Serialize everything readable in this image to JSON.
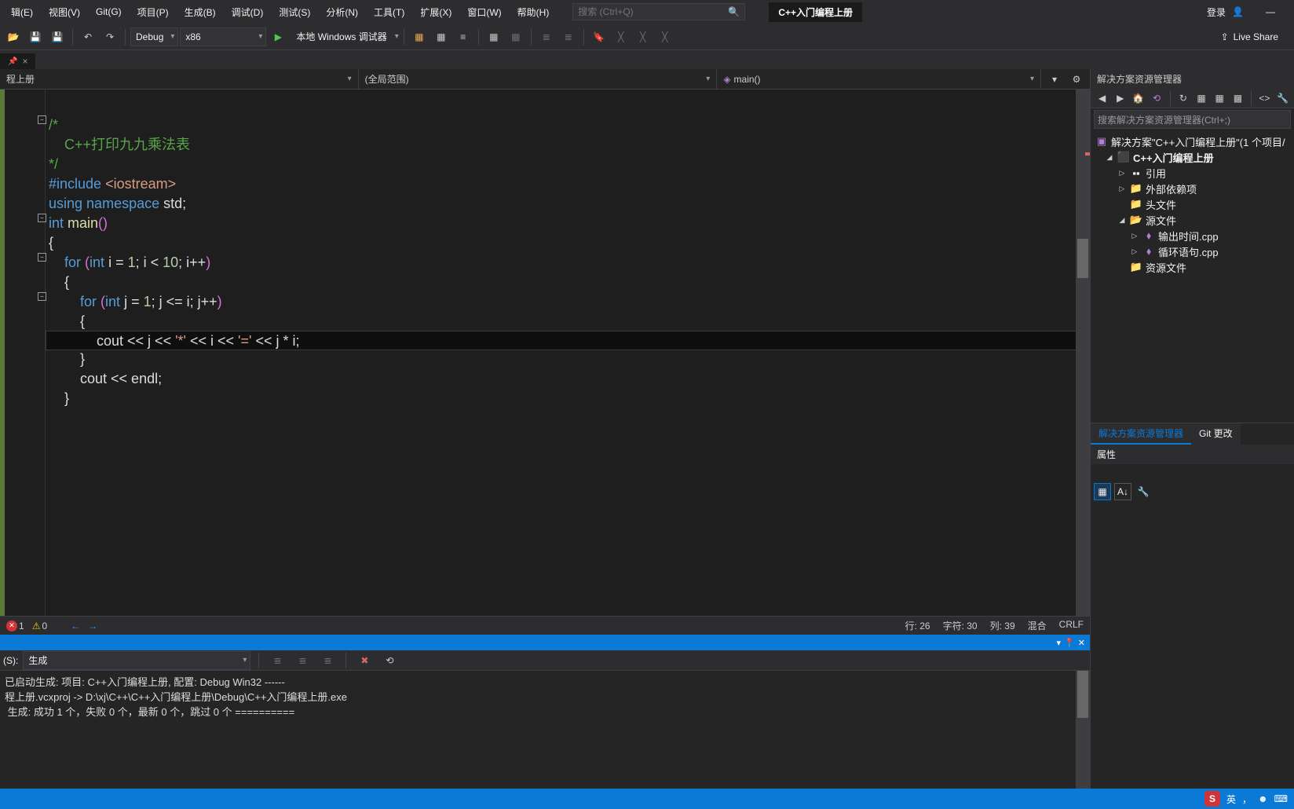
{
  "menu": {
    "items": [
      "辑(E)",
      "视图(V)",
      "Git(G)",
      "项目(P)",
      "生成(B)",
      "调试(D)",
      "测试(S)",
      "分析(N)",
      "工具(T)",
      "扩展(X)",
      "窗口(W)",
      "帮助(H)"
    ],
    "search_placeholder": "搜索 (Ctrl+Q)",
    "project_badge": "C++入门编程上册",
    "login": "登录"
  },
  "toolbar": {
    "config": "Debug",
    "platform": "x86",
    "debugger": "本地 Windows 调试器",
    "liveshare": "Live Share"
  },
  "tab": {
    "name": "",
    "close": "×"
  },
  "navbar": {
    "col1": "程上册",
    "col2": "(全局范围)",
    "col3": "main()"
  },
  "code": {
    "lines": [
      "",
      "  /*",
      "      C++打印九九乘法表",
      "  */",
      "  #include <iostream>",
      "  using namespace std;",
      "  int main()",
      "  {",
      "      for (int i = 1; i < 10; i++)",
      "      {",
      "          for (int j = 1; j <= i; j++)",
      "          {",
      "              cout << j << '*' << i << '=' << j * i;",
      "          }",
      "          cout << endl;",
      "      }",
      ""
    ]
  },
  "status": {
    "errors": "1",
    "warnings": "0",
    "line": "行: 26",
    "char": "字符: 30",
    "col": "列: 39",
    "mixed": "混合",
    "crlf": "CRLF"
  },
  "output": {
    "title": "",
    "source_label": "(S):",
    "source_value": "生成",
    "lines": [
      "已启动生成: 项目: C++入门编程上册, 配置: Debug Win32 ------",
      "程上册.vcxproj -> D:\\xj\\C++\\C++入门编程上册\\Debug\\C++入门编程上册.exe",
      " 生成: 成功 1 个，失败 0 个，最新 0 个，跳过 0 个 =========="
    ]
  },
  "explorer": {
    "title": "解决方案资源管理器",
    "search_placeholder": "搜索解决方案资源管理器(Ctrl+;)",
    "solution": "解决方案\"C++入门编程上册\"(1 个项目/",
    "project": "C++入门编程上册",
    "nodes": {
      "refs": "引用",
      "external": "外部依赖项",
      "headers": "头文件",
      "sources": "源文件",
      "file1": "输出时间.cpp",
      "file2": "循环语句.cpp",
      "resources": "资源文件"
    },
    "tabs": {
      "sol": "解决方案资源管理器",
      "git": "Git 更改"
    },
    "props": "属性"
  },
  "taskbar": {
    "ime": "S",
    "lang": "英"
  }
}
